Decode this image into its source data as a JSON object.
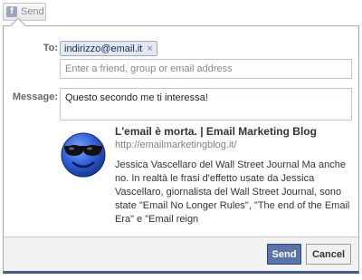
{
  "top_button": {
    "label": "Send",
    "icon": "facebook-icon",
    "icon_glyph": "f"
  },
  "dialog": {
    "to_label": "To:",
    "recipients": [
      {
        "value": "indirizzo@email.it",
        "remove_glyph": "×"
      }
    ],
    "friend_input_placeholder": "Enter a friend, group or email address",
    "message_label": "Message:",
    "message_value": "Questo secondo me ti interessa!"
  },
  "link_preview": {
    "title": "L'email è morta. | Email Marketing Blog",
    "url": "http://emailmarketingblog.it/",
    "description": "Jessica Vascellaro del Wall Street Journal Ma anche no. In realtà le frasi d'effetto usate da Jessica Vascellaro, giornalista del Wall Street Journal, sono state \"Email No Longer Rules\", \"The end of the Email Era\" e \"Email reign",
    "thumbnail": "smiley-sunglasses-icon"
  },
  "footer": {
    "send_label": "Send",
    "cancel_label": "Cancel"
  },
  "colors": {
    "facebook_blue": "#3b5998",
    "send_button": "#5b74a8",
    "token_bg": "#e2e8f3"
  }
}
